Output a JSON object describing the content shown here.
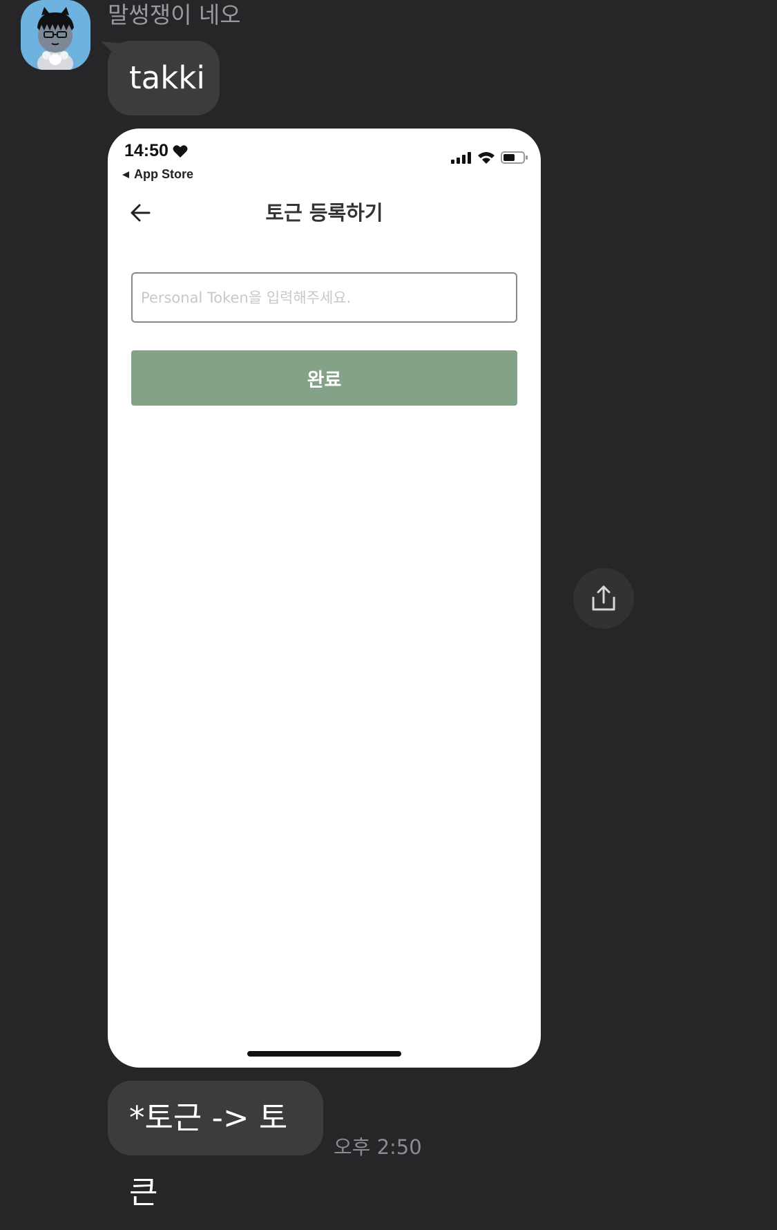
{
  "chat": {
    "sender_name": "말썽쟁이 네오",
    "messages": [
      {
        "text": "takki"
      },
      {
        "text": "*토근 -> 토큰"
      }
    ],
    "timestamp": "오후 2:50"
  },
  "screenshot": {
    "status_bar": {
      "time": "14:50",
      "back_app": "App Store"
    },
    "nav": {
      "title": "토근 등록하기"
    },
    "token_input": {
      "placeholder": "Personal Token을 입력해주세요.",
      "value": ""
    },
    "done_button": {
      "label": "완료"
    }
  },
  "colors": {
    "background": "#262628",
    "bubble": "#3c3c3e",
    "done_button": "#84a287",
    "avatar_bg": "#6eb3e0"
  },
  "icons": [
    "heart-icon",
    "back-triangle-icon",
    "signal-icon",
    "wifi-icon",
    "battery-icon",
    "back-arrow-icon",
    "share-icon"
  ]
}
